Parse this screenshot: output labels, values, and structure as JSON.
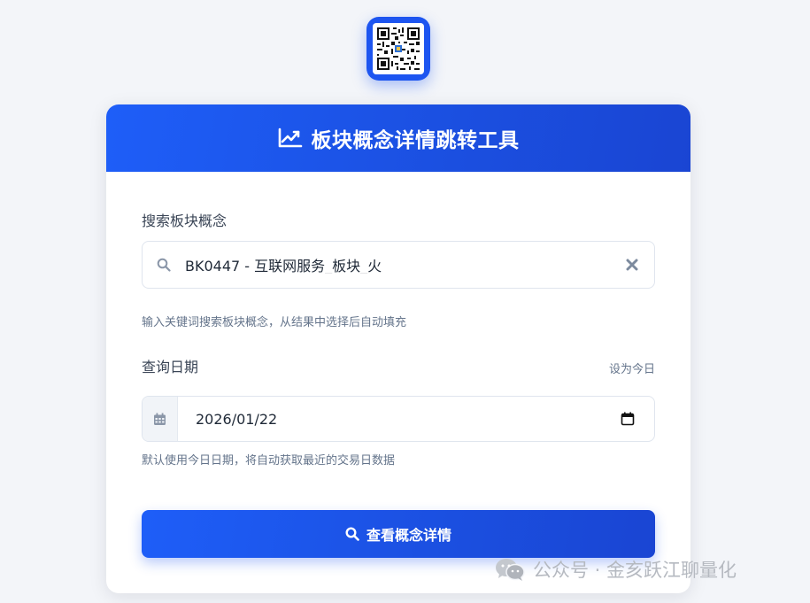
{
  "header": {
    "title": "板块概念详情跳转工具",
    "icon": "chart-line-icon"
  },
  "search": {
    "label": "搜索板块概念",
    "value": "BK0447 - 互联网服务_板块_火",
    "hint": "输入关键词搜索板块概念，从结果中选择后自动填充",
    "icon": "search-icon"
  },
  "date": {
    "label": "查询日期",
    "set_today": "设为今日",
    "value": "2026/01/22",
    "hint": "默认使用今日日期，将自动获取最近的交易日数据",
    "icon": "calendar-icon"
  },
  "submit": {
    "label": "查看概念详情"
  },
  "watermark": {
    "text": "公众号 · 金亥跃江聊量化"
  },
  "colors": {
    "primary": "#1d55f0",
    "background": "#f3f5f9",
    "card": "#ffffff",
    "muted_text": "#64748b"
  }
}
